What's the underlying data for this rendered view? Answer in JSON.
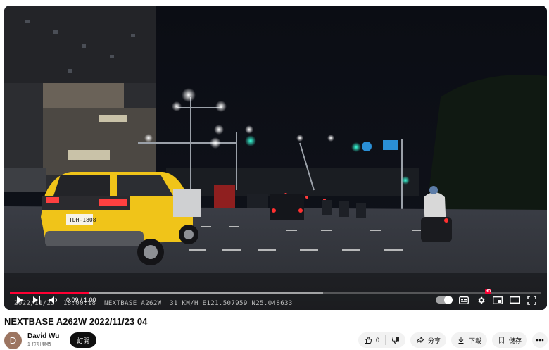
{
  "video": {
    "overlay": "2022/11/23  18:00:18  NEXTBASE A262W  31 KM/H E121.507959 N25.048633",
    "current_time": "0:09",
    "duration": "1:00",
    "progress": 0.15,
    "buffered": 0.59,
    "autoplay": true
  },
  "controls": {
    "play_icon": "play-icon",
    "next_icon": "next-icon",
    "volume_icon": "volume-icon",
    "autoplay_icon": "autoplay-toggle",
    "subtitles_icon": "subtitles-icon",
    "settings_icon": "gear-icon",
    "settings_badge": "HD",
    "miniplayer_icon": "miniplayer-icon",
    "theater_icon": "theater-icon",
    "fullscreen_icon": "fullscreen-icon"
  },
  "meta": {
    "title": "NEXTBASE A262W 2022/11/23 04",
    "channel_name": "David Wu",
    "avatar_letter": "D",
    "subscribers": "1 位訂閱者",
    "subscribe_label": "訂閱",
    "like_count": "0",
    "share_label": "分享",
    "download_label": "下載",
    "save_label": "儲存"
  },
  "colors": {
    "accent": "#ff0033",
    "avatar": "#9c7561",
    "taxi": "#f0c419"
  }
}
